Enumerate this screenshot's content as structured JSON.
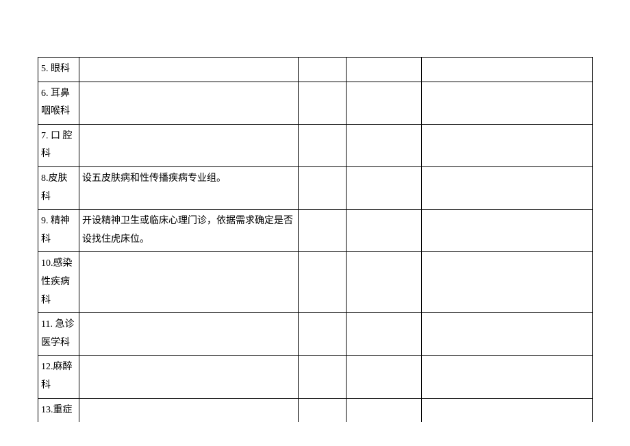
{
  "rows": [
    {
      "c1": "5. 眼科",
      "c2": "",
      "c3": "",
      "c4": "",
      "c5": ""
    },
    {
      "c1": "6. 耳鼻咽喉科",
      "c2": "",
      "c3": "",
      "c4": "",
      "c5": ""
    },
    {
      "c1": "7. 口 腔科",
      "c2": "",
      "c3": "",
      "c4": "",
      "c5": ""
    },
    {
      "c1": "8.皮肤科",
      "c2": "设五皮肤病和性传播疾病专业组。",
      "c3": "",
      "c4": "",
      "c5": ""
    },
    {
      "c1": "9. 精神科",
      "c2": "开设精神卫生或临床心理门诊，依据需求确定是否设找住虎床位。",
      "c3": "",
      "c4": "",
      "c5": ""
    },
    {
      "c1": "10.感染性疾病科",
      "c2": "",
      "c3": "",
      "c4": "",
      "c5": ""
    },
    {
      "c1": "11. 急诊医学科",
      "c2": "",
      "c3": "",
      "c4": "",
      "c5": ""
    },
    {
      "c1": "12.麻醉科",
      "c2": "",
      "c3": "",
      "c4": "",
      "c5": ""
    },
    {
      "c1": "13.重症",
      "c2": "",
      "c3": "",
      "c4": "",
      "c5": ""
    }
  ]
}
